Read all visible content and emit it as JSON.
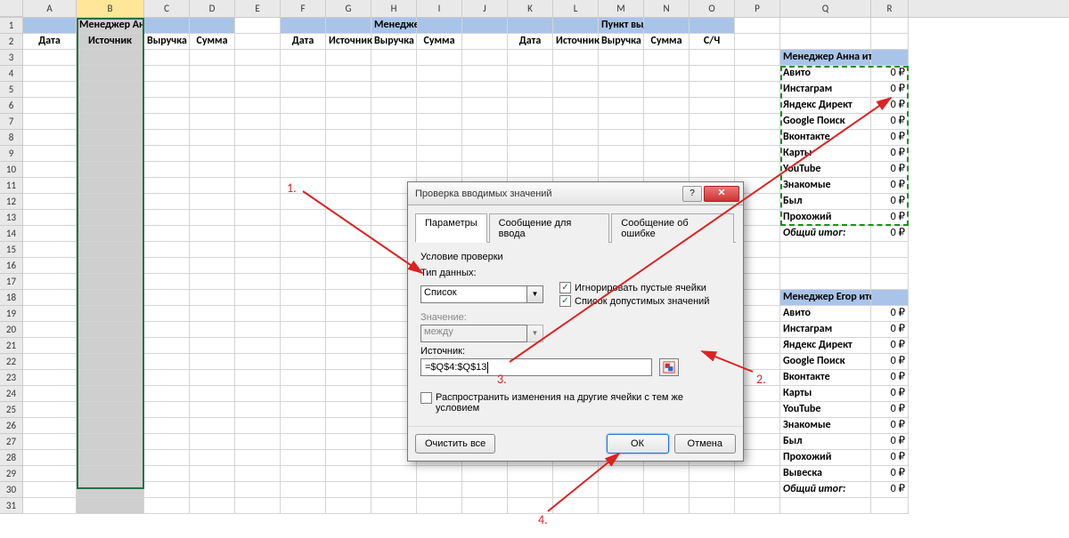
{
  "columns": [
    "A",
    "B",
    "C",
    "D",
    "E",
    "F",
    "G",
    "H",
    "I",
    "J",
    "K",
    "L",
    "M",
    "N",
    "O",
    "P",
    "Q",
    "R"
  ],
  "colWidths": {
    "_rowhdr": 26,
    "A": 60,
    "B": 76,
    "C": 51,
    "D": 51,
    "E": 51,
    "F": 51,
    "G": 51,
    "H": 51,
    "I": 51,
    "J": 51,
    "K": 51,
    "L": 51,
    "M": 51,
    "N": 51,
    "O": 51,
    "P": 51,
    "Q": 102,
    "R": 42
  },
  "selectedColumn": "B",
  "rowCount": 31,
  "section1": {
    "title": "Менеджер Анна",
    "cols": [
      "Дата",
      "Источник",
      "Выручка",
      "Сумма"
    ],
    "span": [
      "A",
      "D"
    ]
  },
  "section2": {
    "title": "Менеджер Егор",
    "cols": [
      "Дата",
      "Источник",
      "Выручка",
      "Сумма"
    ],
    "span": [
      "F",
      "J"
    ]
  },
  "section3": {
    "title": "Пункт выдачи Москва",
    "cols": [
      "Дата",
      "Источник",
      "Выручка",
      "Сумма",
      "С/Ч"
    ],
    "span": [
      "K",
      "O"
    ]
  },
  "summaryA": {
    "title": "Менеджер Анна итоги",
    "rows": [
      {
        "label": "Авито",
        "value": "0 ₽"
      },
      {
        "label": "Инстаграм",
        "value": "0 ₽"
      },
      {
        "label": "Яндекс Директ",
        "value": "0 ₽"
      },
      {
        "label": "Google Поиск",
        "value": "0 ₽"
      },
      {
        "label": "Вконтакте",
        "value": "0 ₽"
      },
      {
        "label": "Карты",
        "value": "0 ₽"
      },
      {
        "label": "YouTube",
        "value": "0 ₽"
      },
      {
        "label": "Знакомые",
        "value": "0 ₽"
      },
      {
        "label": "Был",
        "value": "0 ₽"
      },
      {
        "label": "Прохожий",
        "value": "0 ₽"
      }
    ],
    "total": {
      "label": "Общий итог:",
      "value": "0 ₽"
    }
  },
  "summaryB": {
    "title": "Менеджер Егор итоги",
    "rows": [
      {
        "label": "Авито",
        "value": "0 ₽"
      },
      {
        "label": "Инстаграм",
        "value": "0 ₽"
      },
      {
        "label": "Яндекс Директ",
        "value": "0 ₽"
      },
      {
        "label": "Google Поиск",
        "value": "0 ₽"
      },
      {
        "label": "Вконтакте",
        "value": "0 ₽"
      },
      {
        "label": "Карты",
        "value": "0 ₽"
      },
      {
        "label": "YouTube",
        "value": "0 ₽"
      },
      {
        "label": "Знакомые",
        "value": "0 ₽"
      },
      {
        "label": "Был",
        "value": "0 ₽"
      },
      {
        "label": "Прохожий",
        "value": "0 ₽"
      },
      {
        "label": "Вывеска",
        "value": "0 ₽"
      }
    ],
    "total": {
      "label": "Общий итог:",
      "value": "0 ₽"
    }
  },
  "dialog": {
    "title": "Проверка вводимых значений",
    "tabs": [
      "Параметры",
      "Сообщение для ввода",
      "Сообщение об ошибке"
    ],
    "activeTab": 0,
    "groupTitle": "Условие проверки",
    "dataTypeLabel": "Тип данных:",
    "dataType": "Список",
    "ignoreBlank": {
      "label": "Игнорировать пустые ячейки",
      "checked": true
    },
    "inCellDropdown": {
      "label": "Список допустимых значений",
      "checked": true
    },
    "valueLabel": "Значение:",
    "valueSelect": "между",
    "sourceLabel": "Источник:",
    "source": "=$Q$4:$Q$13",
    "propagate": {
      "label": "Распространить изменения на другие ячейки с тем же условием",
      "checked": false
    },
    "clearAll": "Очистить все",
    "ok": "ОК",
    "cancel": "Отмена"
  },
  "annotations": {
    "n1": "1.",
    "n2": "2.",
    "n3": "3.",
    "n4": "4."
  }
}
